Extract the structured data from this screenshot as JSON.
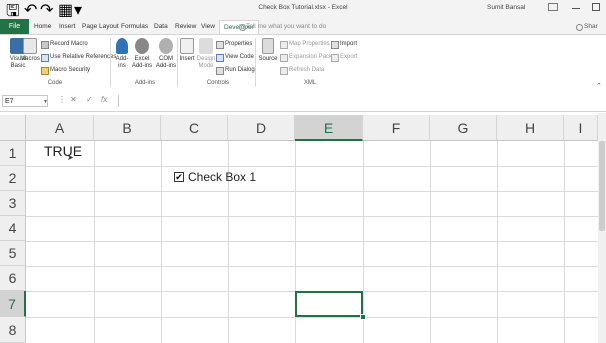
{
  "window": {
    "title": "Check Box Tutorial.xlsx  -  Excel",
    "user": "Sumit Bansal"
  },
  "tabs": [
    "File",
    "Home",
    "Insert",
    "Page Layout",
    "Formulas",
    "Data",
    "Review",
    "View",
    "Developer"
  ],
  "active_tab": "Developer",
  "tell_me": "Tell me what you want to do",
  "share": "Shar",
  "ribbon": {
    "code": {
      "label": "Code",
      "visual_basic": [
        "Visual",
        "Basic"
      ],
      "macros": "Macros",
      "record_macro": "Record Macro",
      "relative_refs": "Use Relative References",
      "macro_security": "Macro Security"
    },
    "addins": {
      "label": "Add-ins",
      "addins": [
        "Add-",
        "ins"
      ],
      "excel_addins": [
        "Excel",
        "Add-ins"
      ],
      "com_addins": [
        "COM",
        "Add-ins"
      ]
    },
    "controls": {
      "label": "Controls",
      "insert": "Insert",
      "design_mode": [
        "Design",
        "Mode"
      ],
      "properties": "Properties",
      "view_code": "View Code",
      "run_dialog": "Run Dialog"
    },
    "xml": {
      "label": "XML",
      "source": "Source",
      "map_properties": "Map Properties",
      "expansion_packs": "Expansion Packs",
      "refresh_data": "Refresh Data",
      "import": "Import",
      "export": "Export"
    }
  },
  "formula_bar": {
    "name_box": "E7",
    "formula": ""
  },
  "columns": [
    "A",
    "B",
    "C",
    "D",
    "E",
    "F",
    "G",
    "H",
    "I"
  ],
  "rows": [
    "1",
    "2",
    "3",
    "4",
    "5",
    "6",
    "7",
    "8"
  ],
  "selected_cell": {
    "column": "E",
    "row": "7"
  },
  "cells": {
    "A1": "TRUE"
  },
  "checkbox": {
    "label": "Check Box 1",
    "checked": true,
    "mark": "✔"
  },
  "colors": {
    "accent": "#217346",
    "header_bg": "#efefef"
  }
}
